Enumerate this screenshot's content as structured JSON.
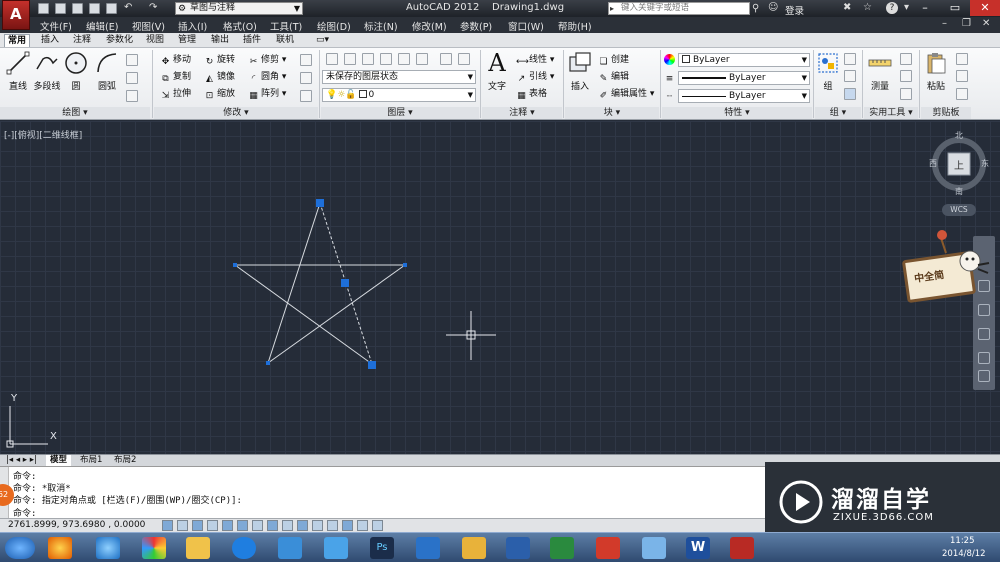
{
  "titlebar": {
    "workspace": "草图与注释",
    "app_name": "AutoCAD 2012",
    "document": "Drawing1.dwg",
    "search_placeholder": "键入关键字或短语",
    "login": "登录"
  },
  "menubar": {
    "items": [
      "文件(F)",
      "编辑(E)",
      "视图(V)",
      "插入(I)",
      "格式(O)",
      "工具(T)",
      "绘图(D)",
      "标注(N)",
      "修改(M)",
      "参数(P)",
      "窗口(W)",
      "帮助(H)"
    ]
  },
  "ribbon_tabs": [
    "常用",
    "插入",
    "注释",
    "参数化",
    "视图",
    "管理",
    "输出",
    "插件",
    "联机"
  ],
  "ribbon": {
    "draw": {
      "title": "绘图",
      "line": "直线",
      "polyline": "多段线",
      "circle": "圆",
      "arc": "圆弧"
    },
    "modify": {
      "title": "修改",
      "move": "移动",
      "rotate": "旋转",
      "trim": "修剪",
      "copy": "复制",
      "mirror": "镜像",
      "fillet": "圆角",
      "stretch": "拉伸",
      "scale": "缩放",
      "array": "阵列"
    },
    "layers": {
      "title": "图层",
      "layer_state": "未保存的图层状态",
      "current_layer": "0"
    },
    "annotation": {
      "title": "注释",
      "text": "文字",
      "linear": "线性",
      "leader": "引线",
      "table": "表格"
    },
    "block": {
      "title": "块",
      "insert": "插入",
      "create": "创建",
      "edit": "编辑",
      "edit_attributes": "编辑属性"
    },
    "properties": {
      "title": "特性",
      "color": "ByLayer",
      "linetype": "ByLayer",
      "lineweight": "ByLayer"
    },
    "groups": {
      "title": "组",
      "group": "组"
    },
    "utilities": {
      "title": "实用工具",
      "measure": "测量"
    },
    "clipboard": {
      "title": "剪贴板",
      "paste": "粘贴"
    }
  },
  "viewport": {
    "label": "[-][俯视][二维线框]"
  },
  "navcube": {
    "north": "北",
    "south": "南",
    "east": "东",
    "west": "西",
    "top": "上",
    "wcs": "WCS"
  },
  "sign": {
    "text": "中全简"
  },
  "layout_tabs": [
    "模型",
    "布局1",
    "布局2"
  ],
  "command_history": [
    "命令:",
    "命令: *取消*",
    "命令: 指定对角点或 [栏选(F)/圈围(WP)/圈交(CP)]:",
    "命令:"
  ],
  "command_badge": "62",
  "status": {
    "coordinates": "2761.8999, 973.6980 , 0.0000"
  },
  "watermark": {
    "title": "溜溜自学",
    "url": "ZIXUE.3D66.COM"
  },
  "taskbar": {
    "time": "11:25",
    "date": "2014/8/12"
  },
  "colors": {
    "canvas": "#252c38",
    "grid": "#2f3746",
    "grip": "#1e6fd9",
    "title_bar": "#2b3038"
  }
}
